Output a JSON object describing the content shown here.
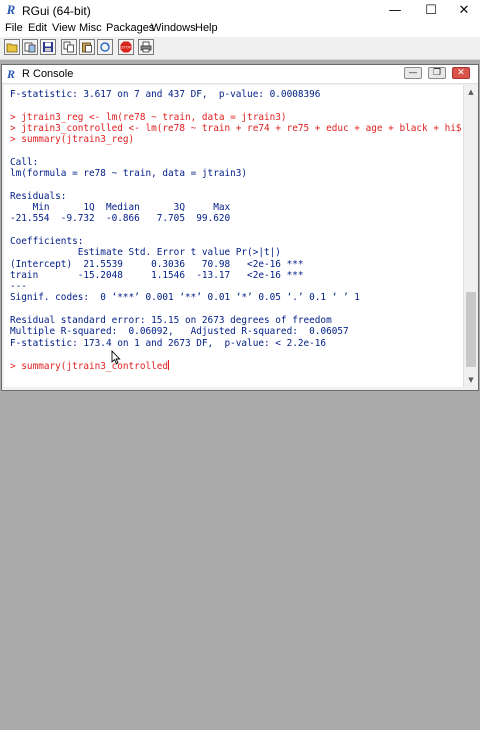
{
  "app": {
    "logo_letter": "R",
    "title": "RGui (64-bit)",
    "controls": {
      "minimize": "—",
      "maximize": "☐",
      "close": "✕"
    }
  },
  "menu": [
    "File",
    "Edit",
    "View",
    "Misc",
    "Packages",
    "Windows",
    "Help"
  ],
  "toolbar": {
    "buttons": [
      "open-script-icon",
      "load-workspace-icon",
      "save-icon",
      "copy-icon",
      "paste-icon",
      "copy-paste-icon",
      "stop-icon",
      "print-icon"
    ],
    "stop_label": "STOP"
  },
  "console": {
    "title": "R Console",
    "icon_letter": "R",
    "controls": {
      "minimize": "—",
      "restore": "❐",
      "close": "✕"
    },
    "lines": [
      {
        "text": "F-statistic: 3.617 on 7 and 437 DF,  p-value: 0.0008396",
        "kind": "output"
      },
      {
        "text": "",
        "kind": "output"
      },
      {
        "text": "> jtrain3_reg <- lm(re78 ~ train, data = jtrain3)",
        "kind": "cmd"
      },
      {
        "text": "> jtrain3_controlled <- lm(re78 ~ train + re74 + re75 + educ + age + black + hi$",
        "kind": "cmd"
      },
      {
        "text": "> summary(jtrain3_reg)",
        "kind": "cmd"
      },
      {
        "text": "",
        "kind": "output"
      },
      {
        "text": "Call:",
        "kind": "output"
      },
      {
        "text": "lm(formula = re78 ~ train, data = jtrain3)",
        "kind": "output"
      },
      {
        "text": "",
        "kind": "output"
      },
      {
        "text": "Residuals:",
        "kind": "output"
      },
      {
        "text": "    Min      1Q  Median      3Q     Max",
        "kind": "output"
      },
      {
        "text": "-21.554  -9.732  -0.866   7.705  99.620",
        "kind": "output"
      },
      {
        "text": "",
        "kind": "output"
      },
      {
        "text": "Coefficients:",
        "kind": "output"
      },
      {
        "text": "            Estimate Std. Error t value Pr(>|t|)",
        "kind": "output"
      },
      {
        "text": "(Intercept)  21.5539     0.3036   70.98   <2e-16 ***",
        "kind": "output"
      },
      {
        "text": "train       -15.2048     1.1546  -13.17   <2e-16 ***",
        "kind": "output"
      },
      {
        "text": "---",
        "kind": "output"
      },
      {
        "text": "Signif. codes:  0 ‘***’ 0.001 ‘**’ 0.01 ‘*’ 0.05 ‘.’ 0.1 ‘ ’ 1",
        "kind": "output"
      },
      {
        "text": "",
        "kind": "output"
      },
      {
        "text": "Residual standard error: 15.15 on 2673 degrees of freedom",
        "kind": "output"
      },
      {
        "text": "Multiple R-squared:  0.06092,\tAdjusted R-squared:  0.06057 ",
        "kind": "output"
      },
      {
        "text": "F-statistic: 173.4 on 1 and 2673 DF,  p-value: < 2.2e-16",
        "kind": "output"
      },
      {
        "text": "",
        "kind": "output"
      },
      {
        "text": "> summary(jtrain3_controlled",
        "kind": "cmd"
      }
    ],
    "scroll_arrows": {
      "up": "▲",
      "down": "▼"
    }
  }
}
